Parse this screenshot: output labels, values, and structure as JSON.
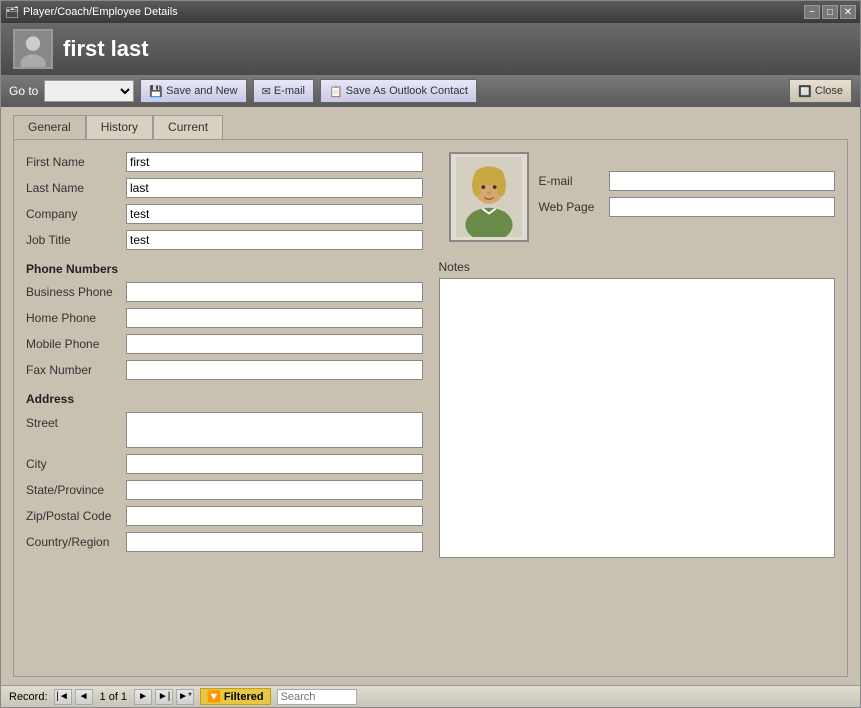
{
  "window": {
    "title": "Player/Coach/Employee Details",
    "minimize": "−",
    "restore": "□",
    "close": "✕"
  },
  "header": {
    "title": "first last",
    "icon_label": "person-icon"
  },
  "toolbar": {
    "goto_label": "Go to",
    "goto_placeholder": "",
    "save_and_new_label": "Save and New",
    "email_label": "E-mail",
    "save_as_outlook_label": "Save As Outlook Contact",
    "close_label": "Close"
  },
  "tabs": {
    "general": "General",
    "history": "History",
    "current": "Current"
  },
  "form": {
    "first_name_label": "First Name",
    "first_name_value": "first",
    "last_name_label": "Last Name",
    "last_name_value": "last",
    "company_label": "Company",
    "company_value": "test",
    "job_title_label": "Job Title",
    "job_title_value": "test",
    "phone_numbers_title": "Phone Numbers",
    "business_phone_label": "Business Phone",
    "business_phone_value": "",
    "home_phone_label": "Home Phone",
    "home_phone_value": "",
    "mobile_phone_label": "Mobile Phone",
    "mobile_phone_value": "",
    "fax_number_label": "Fax Number",
    "fax_number_value": "",
    "address_title": "Address",
    "street_label": "Street",
    "street_value": "",
    "city_label": "City",
    "city_value": "",
    "state_label": "State/Province",
    "state_value": "",
    "zip_label": "Zip/Postal Code",
    "zip_value": "",
    "country_label": "Country/Region",
    "country_value": "",
    "email_label": "E-mail",
    "email_value": "",
    "web_page_label": "Web Page",
    "web_page_value": "",
    "notes_label": "Notes",
    "notes_value": ""
  },
  "status_bar": {
    "record_label": "Record:",
    "first_btn": "|◄",
    "prev_btn": "◄",
    "record_info": "1 of 1",
    "next_btn": "►",
    "last_btn": "►|",
    "new_btn": "►*",
    "filtered_label": "Filtered",
    "search_label": "Search"
  }
}
